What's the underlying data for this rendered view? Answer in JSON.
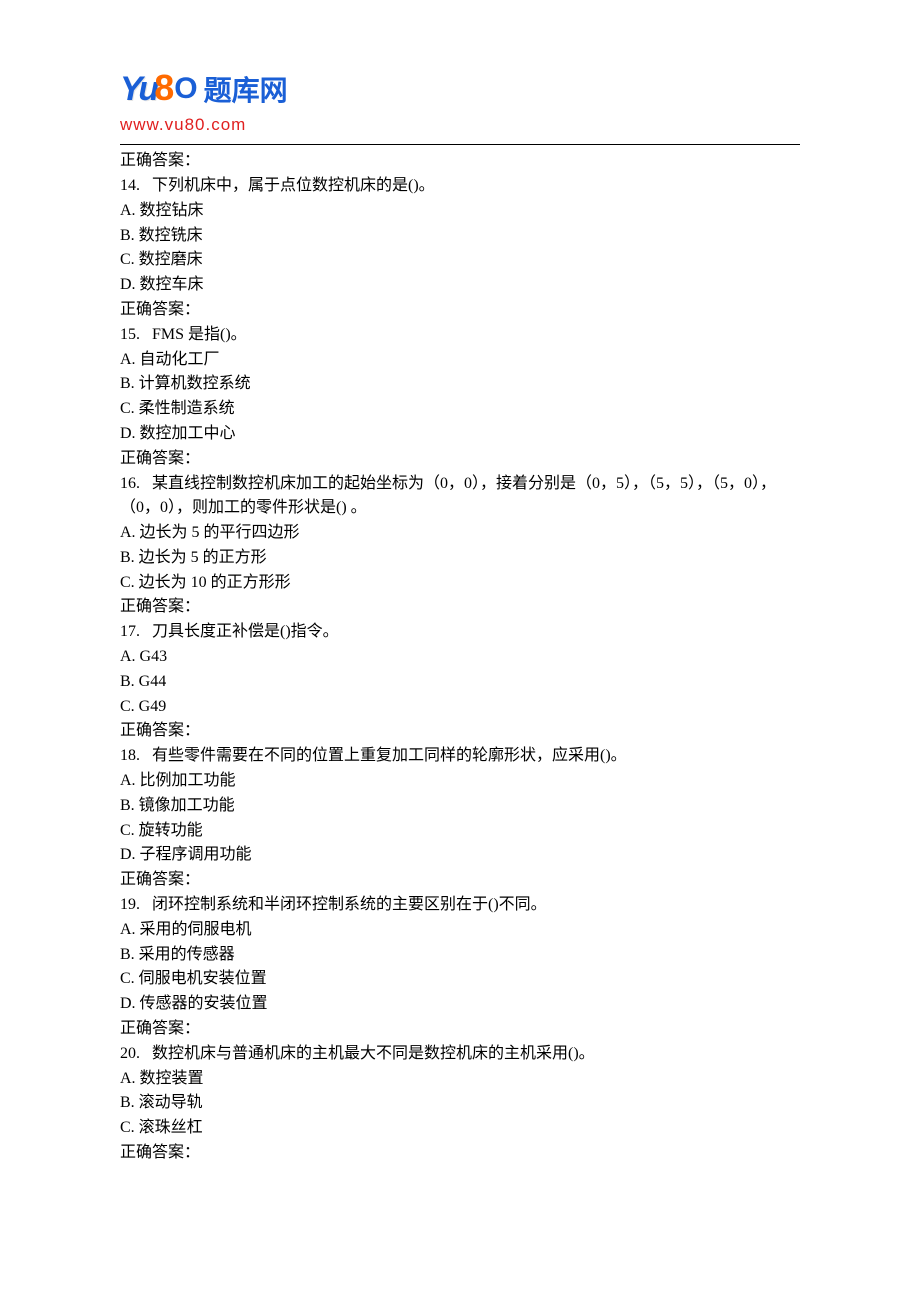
{
  "logo": {
    "brand_yu": "Yu",
    "brand_8": "8",
    "brand_o": "O",
    "brand_cn": "题库网",
    "url": "www.vu80.com"
  },
  "lines": [
    "正确答案：",
    "14.   下列机床中，属于点位数控机床的是()。",
    "A. 数控钻床",
    "B. 数控铣床",
    "C. 数控磨床",
    "D. 数控车床",
    "正确答案：",
    "15.   FMS 是指()。",
    "A. 自动化工厂",
    "B. 计算机数控系统",
    "C. 柔性制造系统",
    "D. 数控加工中心",
    "正确答案：",
    "16.   某直线控制数控机床加工的起始坐标为（0，0），接着分别是（0，5），（5，5），（5，0），（0，0），则加工的零件形状是() 。",
    "A. 边长为 5 的平行四边形",
    "B. 边长为 5 的正方形",
    "C. 边长为 10 的正方形形",
    "正确答案：",
    "17.   刀具长度正补偿是()指令。",
    "A. G43",
    "B. G44",
    "C. G49",
    "正确答案：",
    "18.   有些零件需要在不同的位置上重复加工同样的轮廓形状，应采用()。",
    "A. 比例加工功能",
    "B. 镜像加工功能",
    "C. 旋转功能",
    "D. 子程序调用功能",
    "正确答案：",
    "19.   闭环控制系统和半闭环控制系统的主要区别在于()不同。",
    "A. 采用的伺服电机",
    "B. 采用的传感器",
    "C. 伺服电机安装位置",
    "D. 传感器的安装位置",
    "正确答案：",
    "20.   数控机床与普通机床的主机最大不同是数控机床的主机采用()。",
    "A. 数控装置",
    "B. 滚动导轨",
    "C. 滚珠丝杠",
    "正确答案："
  ]
}
